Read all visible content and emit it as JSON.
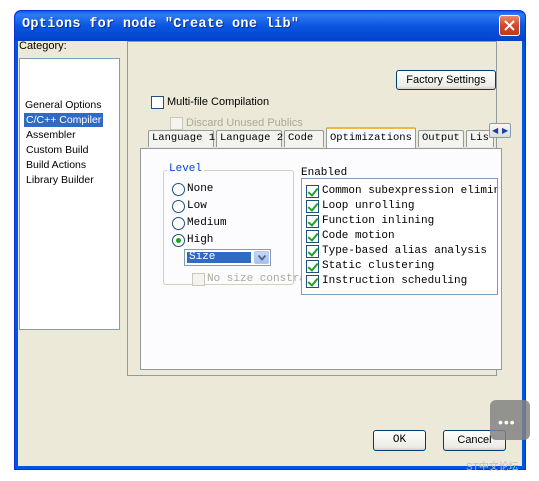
{
  "window": {
    "title": "Options for node \"Create one lib\""
  },
  "category": {
    "label": "Category:",
    "items": [
      {
        "label": "General Options",
        "selected": false
      },
      {
        "label": "C/C++ Compiler",
        "selected": true
      },
      {
        "label": "Assembler",
        "selected": false
      },
      {
        "label": "Custom Build",
        "selected": false
      },
      {
        "label": "Build Actions",
        "selected": false
      },
      {
        "label": "Library Builder",
        "selected": false
      }
    ]
  },
  "toolbar": {
    "factory_settings_label": "Factory Settings",
    "multifile_label": "Multi-file Compilation",
    "discard_label": "Discard Unused Publics"
  },
  "tabs": [
    {
      "label": "Language 1"
    },
    {
      "label": "Language 2"
    },
    {
      "label": "Code"
    },
    {
      "label": "Optimizations"
    },
    {
      "label": "Output"
    },
    {
      "label": "Lis"
    }
  ],
  "level": {
    "legend": "Level",
    "options": [
      {
        "label": "None",
        "checked": false
      },
      {
        "label": "Low",
        "checked": false
      },
      {
        "label": "Medium",
        "checked": false
      },
      {
        "label": "High",
        "checked": true
      }
    ],
    "select_value": "Size",
    "no_size_label": "No size constra"
  },
  "enabled": {
    "label": "Enabled",
    "items": [
      {
        "label": "Common subexpression eliminatio",
        "checked": true
      },
      {
        "label": "Loop unrolling",
        "checked": true
      },
      {
        "label": "Function inlining",
        "checked": true
      },
      {
        "label": "Code motion",
        "checked": true
      },
      {
        "label": "Type-based alias analysis",
        "checked": true
      },
      {
        "label": "Static clustering",
        "checked": true
      },
      {
        "label": "Instruction scheduling",
        "checked": true
      }
    ]
  },
  "footer": {
    "ok_label": "OK",
    "cancel_label": "Cancel"
  },
  "watermark": {
    "text": "ST中文论坛"
  },
  "colors": {
    "title_blue": "#0054e3",
    "selection": "#316ac5",
    "face": "#ece9d8",
    "check": "#21a121"
  }
}
